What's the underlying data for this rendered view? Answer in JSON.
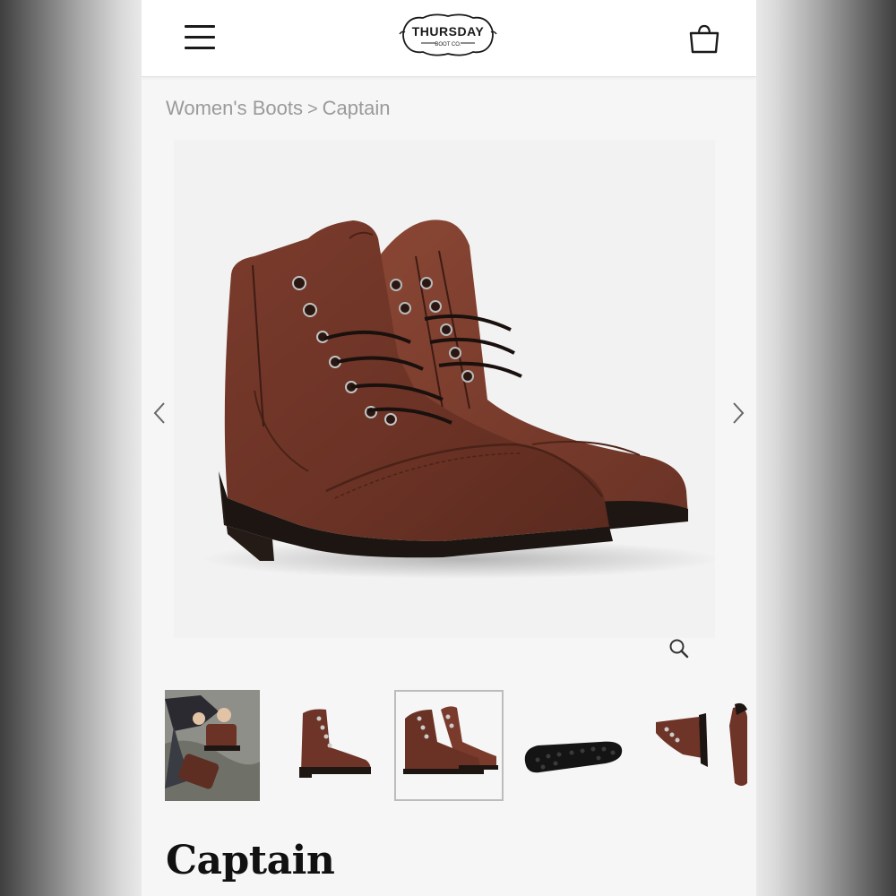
{
  "header": {
    "logo_text": "THURSDAY",
    "logo_subtext": "BOOT CO.",
    "menu_icon": "hamburger-menu-icon",
    "bag_icon": "shopping-bag-icon"
  },
  "breadcrumb": {
    "items": [
      "Women's Boots",
      "Captain"
    ],
    "separator": ">"
  },
  "gallery": {
    "prev_icon": "chevron-left-icon",
    "next_icon": "chevron-right-icon",
    "zoom_icon": "magnifier-icon",
    "thumbnails": [
      {
        "label": "lifestyle-photo"
      },
      {
        "label": "side-view"
      },
      {
        "label": "pair-angle-view",
        "selected": true
      },
      {
        "label": "sole-view"
      },
      {
        "label": "detail-view"
      }
    ]
  },
  "product": {
    "title": "Captain"
  },
  "colors": {
    "leather": "#6b3426",
    "leather_light": "#8a4736",
    "sole": "#1c1512",
    "background": "#f6f6f6",
    "breadcrumb_text": "#9a9a9a"
  }
}
